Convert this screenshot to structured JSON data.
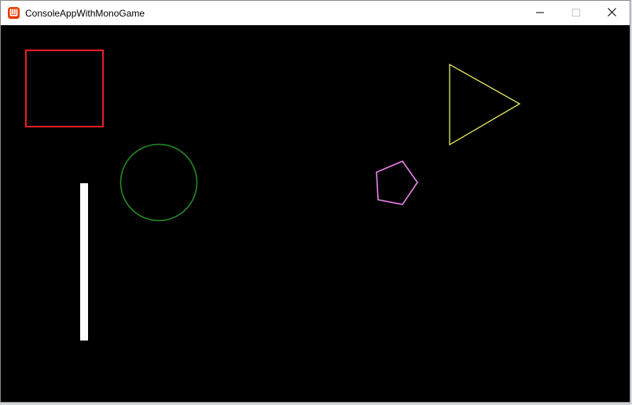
{
  "window": {
    "title": "ConsoleAppWithMonoGame",
    "app_icon": "monogame-logo-icon",
    "controls": {
      "minimize_icon": "minimize-icon",
      "maximize_icon": "maximize-icon",
      "close_icon": "close-icon"
    }
  },
  "game_canvas": {
    "background_color": "#000000",
    "shapes": [
      {
        "name": "rectangle",
        "kind": "outline",
        "color": "#ed1c24"
      },
      {
        "name": "circle",
        "kind": "outline",
        "color": "#228b22"
      },
      {
        "name": "paddle",
        "kind": "filled",
        "color": "#ffffff"
      },
      {
        "name": "pentagon",
        "kind": "outline",
        "color": "#ee82ee"
      },
      {
        "name": "triangle",
        "kind": "outline",
        "color": "#ffff66"
      }
    ]
  }
}
